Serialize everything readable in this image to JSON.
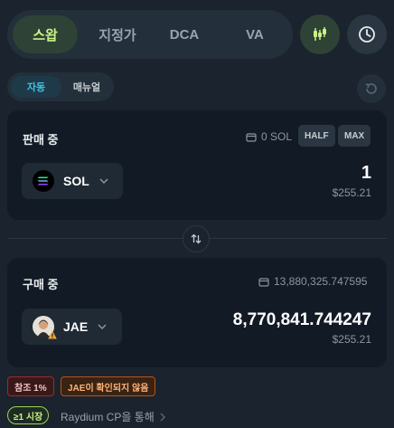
{
  "tabs": [
    {
      "label": "스왑",
      "active": true
    },
    {
      "label": "지정가",
      "active": false
    },
    {
      "label": "DCA",
      "active": false
    },
    {
      "label": "VA",
      "active": false
    }
  ],
  "mode": {
    "auto": "자동",
    "manual": "매뉴얼"
  },
  "sell": {
    "label": "판매 중",
    "balance": "0 SOL",
    "half": "HALF",
    "max": "MAX",
    "token": "SOL",
    "amount": "1",
    "usd": "$255.21"
  },
  "buy": {
    "label": "구매 중",
    "balance": "13,880,325.747595",
    "token": "JAE",
    "amount": "8,770,841.744247",
    "usd": "$255.21"
  },
  "badges": {
    "reference": "참조 1%",
    "unverified": "JAE이 확인되지 않음"
  },
  "route": {
    "market": "≥1 시장",
    "via": "Raydium CP을 통해"
  },
  "colors": {
    "accent": "#c8f284",
    "cyan": "#3fc1e3",
    "warn": "#ffb27a",
    "danger": "#9b2c2c"
  },
  "icons": {
    "chart": "candlestick-chart-icon",
    "history": "clock-icon",
    "refresh": "refresh-icon",
    "wallet": "wallet-icon",
    "swap": "swap-arrows-icon"
  }
}
